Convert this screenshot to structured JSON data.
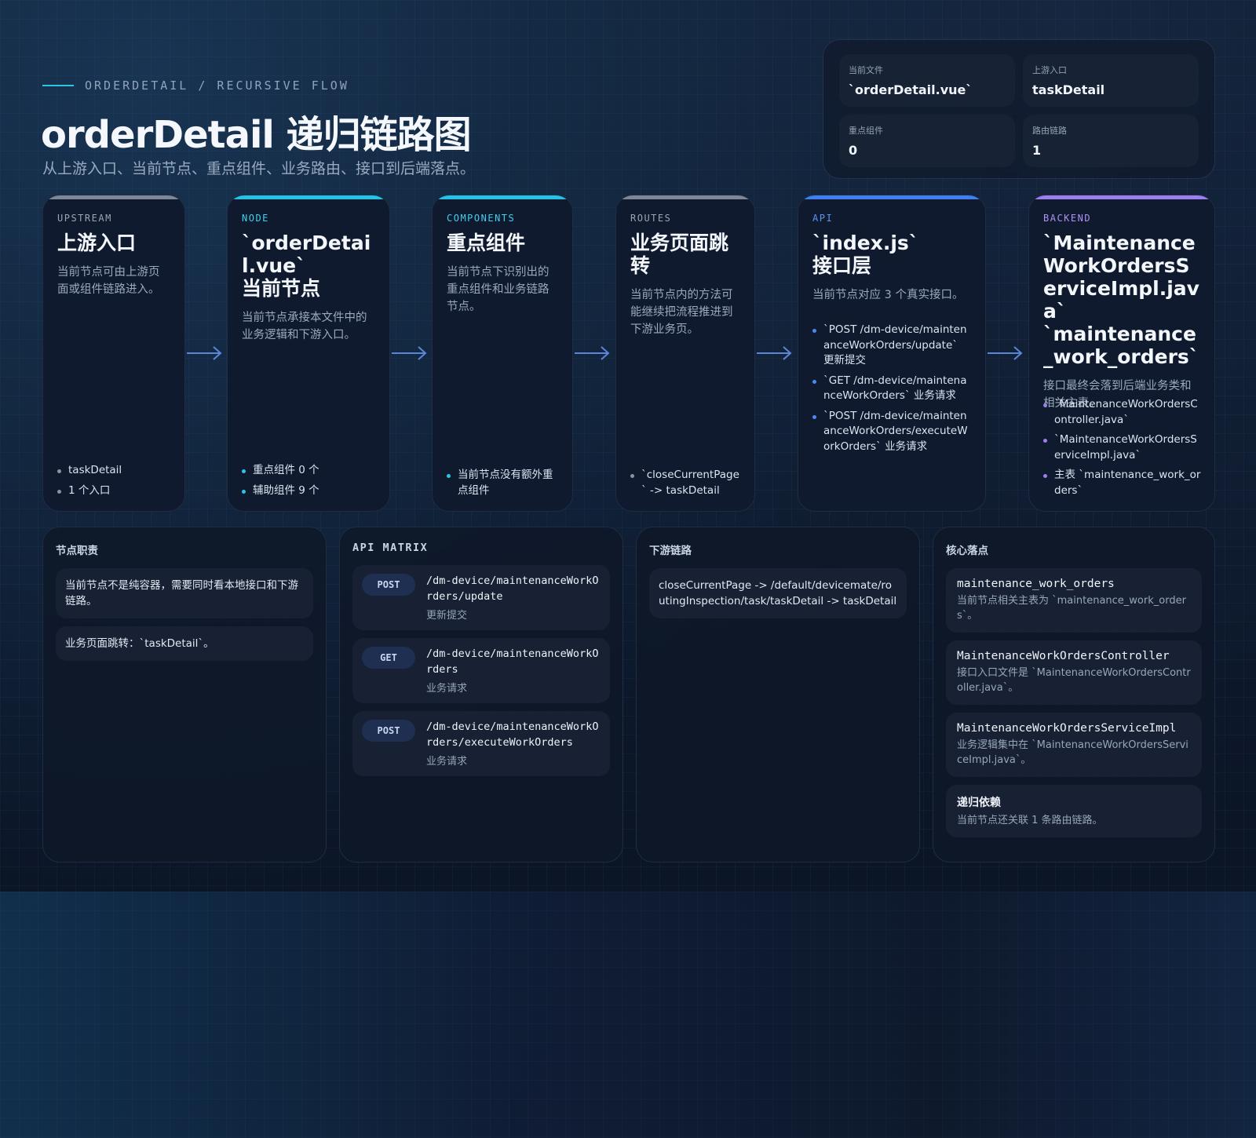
{
  "header": {
    "eyebrow": "ORDERDETAIL / RECURSIVE FLOW",
    "title": "orderDetail 递归链路图",
    "subtitle": "从上游入口、当前节点、重点组件、业务路由、接口到后端落点。"
  },
  "stats": [
    {
      "label": "当前文件",
      "value": "`orderDetail.vue`"
    },
    {
      "label": "上游入口",
      "value": "taskDetail"
    },
    {
      "label": "重点组件",
      "value": "0"
    },
    {
      "label": "路由链路",
      "value": "1"
    }
  ],
  "cards": {
    "upstream": {
      "tag": "UPSTREAM",
      "heading": "上游入口",
      "desc": "当前节点可由上游页面或组件链路进入。",
      "items": [
        "taskDetail",
        "1 个入口"
      ]
    },
    "node": {
      "tag": "NODE",
      "heading1": "`orderDetail.vue`",
      "heading2": "当前节点",
      "desc": "当前节点承接本文件中的业务逻辑和下游入口。",
      "items": [
        "重点组件 0 个",
        "辅助组件 9 个"
      ]
    },
    "components": {
      "tag": "COMPONENTS",
      "heading": "重点组件",
      "desc": "当前节点下识别出的重点组件和业务链路节点。",
      "items": [
        "当前节点没有额外重点组件"
      ]
    },
    "routes": {
      "tag": "ROUTES",
      "heading": "业务页面跳转",
      "desc": "当前节点内的方法可能继续把流程推进到下游业务页。",
      "items": [
        "`closeCurrentPage` -> taskDetail"
      ]
    },
    "api": {
      "tag": "API",
      "heading1": "`index.js`",
      "heading2": "接口层",
      "desc": "当前节点对应 3 个真实接口。",
      "items": [
        "`POST /dm-device/maintenanceWorkOrders/update` 更新提交",
        "`GET /dm-device/maintenanceWorkOrders` 业务请求",
        "`POST /dm-device/maintenanceWorkOrders/executeWorkOrders` 业务请求"
      ]
    },
    "backend": {
      "tag": "BACKEND",
      "heading1": "`MaintenanceWorkOrdersServiceImpl.java`",
      "heading2": "`maintenance_work_orders`",
      "desc": "接口最终会落到后端业务类和相关主表。",
      "items": [
        "`MaintenanceWorkOrdersController.java`",
        "`MaintenanceWorkOrdersServiceImpl.java`",
        "主表 `maintenance_work_orders`"
      ]
    }
  },
  "panels": {
    "duty": {
      "title": "节点职责",
      "boxes": [
        "当前节点不是纯容器，需要同时看本地接口和下游链路。",
        "业务页面跳转：`taskDetail`。"
      ]
    },
    "api_matrix": {
      "title": "API MATRIX",
      "rows": [
        {
          "method": "POST",
          "path": "/dm-device/maintenanceWorkOrders/update",
          "note": "更新提交"
        },
        {
          "method": "GET",
          "path": "/dm-device/maintenanceWorkOrders",
          "note": "业务请求"
        },
        {
          "method": "POST",
          "path": "/dm-device/maintenanceWorkOrders/executeWorkOrders",
          "note": "业务请求"
        }
      ]
    },
    "downstream": {
      "title": "下游链路",
      "boxes": [
        "closeCurrentPage -> /default/devicemate/routingInspection/task/taskDetail -> taskDetail"
      ]
    },
    "core": {
      "title": "核心落点",
      "items": [
        {
          "title": "maintenance_work_orders",
          "desc": "当前节点相关主表为 `maintenance_work_orders`。"
        },
        {
          "title": "MaintenanceWorkOrdersController",
          "desc": "接口入口文件是 `MaintenanceWorkOrdersController.java`。"
        },
        {
          "title": "MaintenanceWorkOrdersServiceImpl",
          "desc": "业务逻辑集中在 `MaintenanceWorkOrdersServiceImpl.java`。"
        },
        {
          "title": "递归依赖",
          "desc": "当前节点还关联 1 条路由链路。"
        }
      ]
    }
  },
  "colors": {
    "upstream": "#7e8797",
    "node": "#22c3e6",
    "components": "#22c3e6",
    "routes": "#7e8797",
    "api": "#3f7ff0",
    "backend": "#9b7ef0",
    "arrow": "#5b86d8"
  }
}
